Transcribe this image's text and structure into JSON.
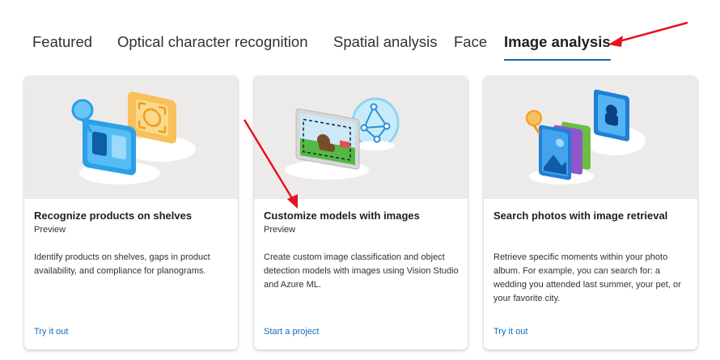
{
  "tabs": [
    {
      "label": "Featured",
      "active": false
    },
    {
      "label": "Optical character recognition",
      "active": false
    },
    {
      "label": "Spatial analysis",
      "active": false
    },
    {
      "label": "Face",
      "active": false
    },
    {
      "label": "Image analysis",
      "active": true
    }
  ],
  "cards": [
    {
      "title": "Recognize products on shelves",
      "badge": "Preview",
      "description": "Identify products on shelves, gaps in product availability, and compliance for planograms.",
      "link": "Try it out",
      "illustration": "product-recognition-illustration"
    },
    {
      "title": "Customize models with images",
      "badge": "Preview",
      "description": "Create custom image classification and object detection models with images using Vision Studio and Azure ML.",
      "link": "Start a project",
      "illustration": "custom-model-illustration"
    },
    {
      "title": "Search photos with image retrieval",
      "badge": "",
      "description": "Retrieve specific moments within your photo album. For example, you can search for: a wedding you attended last summer, your pet, or your favorite city.",
      "link": "Try it out",
      "illustration": "photo-retrieval-illustration"
    }
  ],
  "annotations": {
    "arrow_color": "#e81123",
    "arrows": [
      "arrow-to-image-analysis-tab",
      "arrow-to-customize-models-card"
    ]
  },
  "colors": {
    "accent": "#0f6cbd",
    "hero_background": "#edebe9"
  }
}
